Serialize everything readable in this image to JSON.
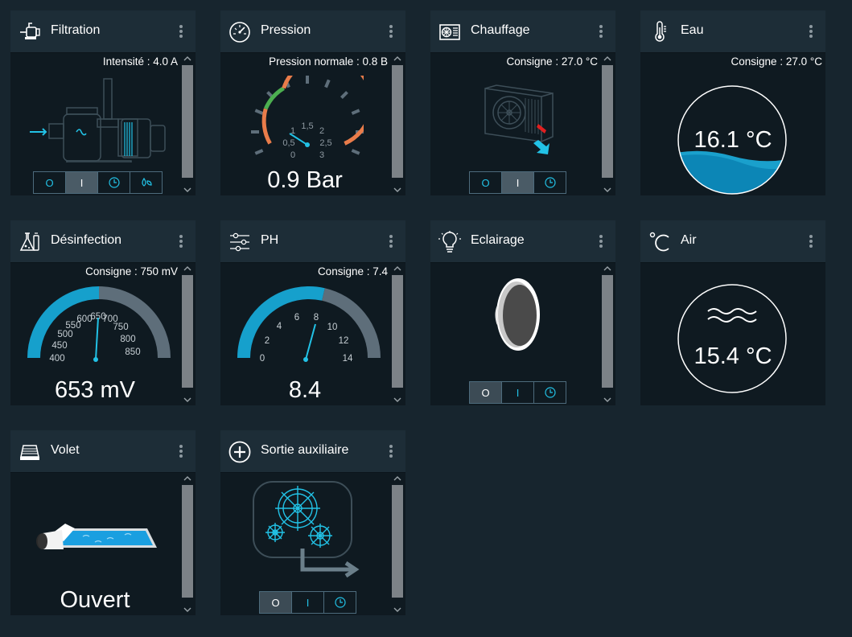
{
  "cards": {
    "filtration": {
      "title": "Filtration",
      "info": "Intensité : 4.0 A",
      "modes": [
        "O",
        "I"
      ]
    },
    "pression": {
      "title": "Pression",
      "info": "Pression normale : 0.8 B",
      "value": "0.9 Bar",
      "ticks": [
        "0",
        "0,5",
        "1",
        "1,5",
        "2",
        "2,5",
        "3"
      ]
    },
    "chauffage": {
      "title": "Chauffage",
      "info": "Consigne : 27.0 °C",
      "modes": [
        "O",
        "I"
      ]
    },
    "eau": {
      "title": "Eau",
      "info": "Consigne : 27.0 °C",
      "value": "16.1 °C"
    },
    "desinfection": {
      "title": "Désinfection",
      "info": "Consigne : 750 mV",
      "value": "653 mV",
      "ticks": [
        "400",
        "450",
        "500",
        "550",
        "600",
        "650",
        "700",
        "750",
        "800",
        "850"
      ]
    },
    "ph": {
      "title": "PH",
      "info": "Consigne : 7.4",
      "value": "8.4",
      "ticks": [
        "0",
        "2",
        "4",
        "6",
        "8",
        "10",
        "12",
        "14"
      ]
    },
    "eclairage": {
      "title": "Eclairage",
      "modes": [
        "O",
        "I"
      ]
    },
    "air": {
      "title": "Air",
      "value": "15.4 °C"
    },
    "volet": {
      "title": "Volet",
      "value": "Ouvert"
    },
    "sortie": {
      "title": "Sortie auxiliaire",
      "modes": [
        "O",
        "I"
      ]
    }
  },
  "colors": {
    "accent": "#22c2e6",
    "gauge_orange": "#e97c4a",
    "gauge_green": "#4caf50",
    "gauge_track": "#5e6e7a"
  }
}
